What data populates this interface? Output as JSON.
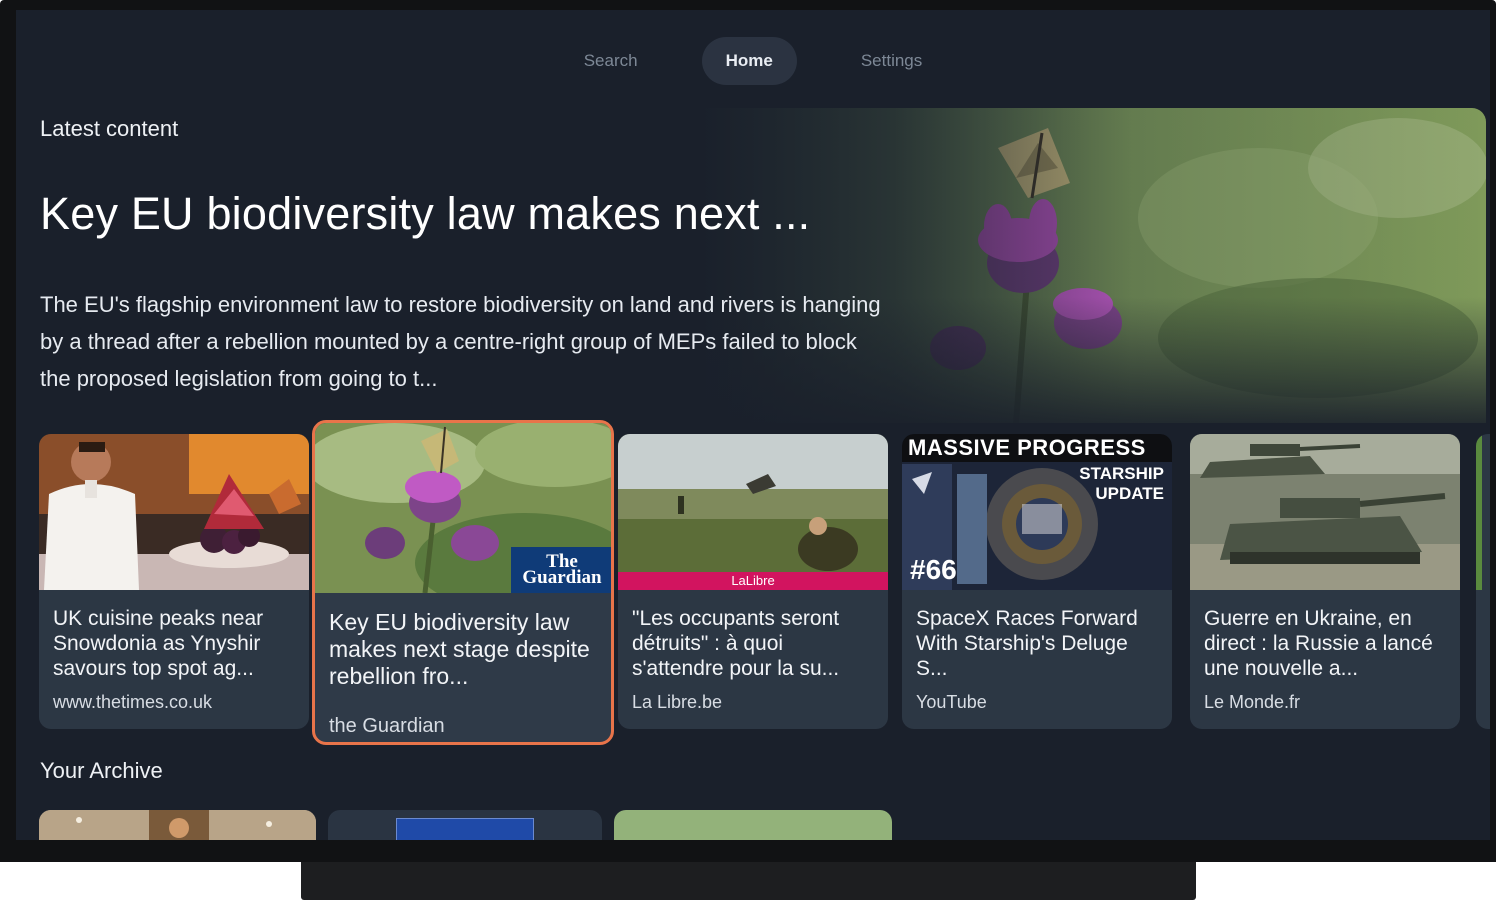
{
  "nav": {
    "items": [
      {
        "label": "Search"
      },
      {
        "label": "Home"
      },
      {
        "label": "Settings"
      }
    ]
  },
  "latest": {
    "section_title": "Latest content",
    "hero_title": "Key EU biodiversity law makes next ...",
    "hero_desc": "The EU's flagship environment law to restore biodiversity on land and rivers is hanging by a thread after a rebellion mounted by a centre-right group of MEPs failed to block the proposed legislation from going to t..."
  },
  "cards": [
    {
      "title": "UK cuisine peaks near Snowdonia as Ynyshir savours top spot ag...",
      "source": "www.thetimes.co.uk"
    },
    {
      "title": "Key EU biodiversity law makes next stage despite rebellion fro...",
      "source": "the Guardian",
      "thumb_badge": "The Guardian"
    },
    {
      "title": "\"Les occupants seront détruits\" : à quoi s'attendre pour la su...",
      "source": "La Libre.be",
      "thumb_badge": "LaLibre"
    },
    {
      "title": "SpaceX Races Forward With Starship's Deluge S...",
      "source": "YouTube",
      "thumb_headline": "MASSIVE PROGRESS",
      "thumb_sub1": "STARSHIP",
      "thumb_sub2": "UPDATE",
      "thumb_number": "#66"
    },
    {
      "title": "Guerre en Ukraine, en direct : la Russie a lancé une nouvelle a...",
      "source": "Le Monde.fr"
    }
  ],
  "archive": {
    "section_title": "Your Archive"
  },
  "colors": {
    "background": "#1a202b",
    "card": "#2c3744",
    "focus": "#e8744a",
    "nav_active": "#2b3341"
  }
}
